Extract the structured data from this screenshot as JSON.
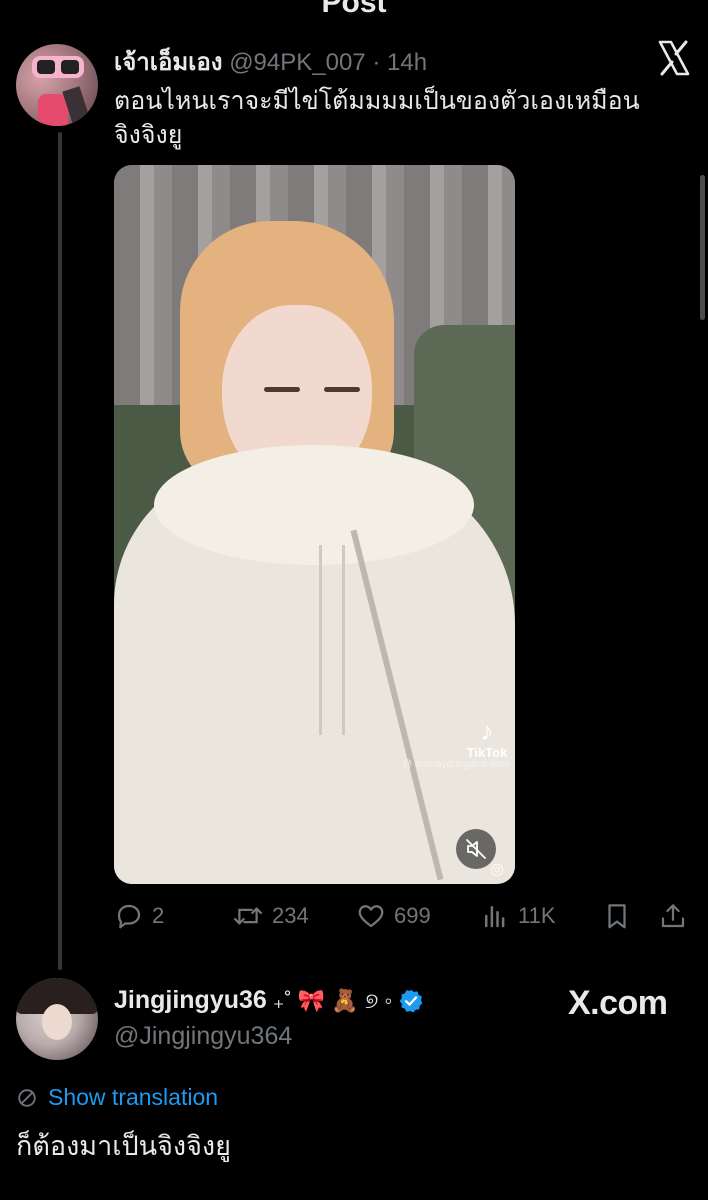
{
  "header": {
    "title": "Post"
  },
  "tweet": {
    "name": "เจ้าเอ็มเอง",
    "handle": "@94PK_007",
    "separator": "·",
    "time": "14h",
    "text_line1": "ตอนไหนเราจะมีไข่โต้มมมมเป็นของตัวเองเหมือน",
    "text_line2": "จิงจิงยู",
    "close_icon": "x-logo-icon"
  },
  "media": {
    "watermark_brand": "TikTok",
    "watermark_glyph": "♪",
    "watermark_user": "@ accnaydungdeduless",
    "mute_icon": "muted-speaker-icon",
    "weibo_icon": "weibo-icon"
  },
  "actions": {
    "replies": "2",
    "reposts": "234",
    "likes": "699",
    "views": "11K",
    "bookmark_icon": "bookmark-icon",
    "share_icon": "share-icon"
  },
  "quote": {
    "name": "Jingjingyu36",
    "emoji": "₊˚ 🎀 🧸 ୭ ◦",
    "verified_color": "#1d9bf0",
    "handle": "@Jingjingyu364",
    "brand": "X.com"
  },
  "translation": {
    "label": "Show translation"
  },
  "reply": {
    "text": "ก็ต้องมาเป็นจิงจิงยู"
  },
  "colors": {
    "background": "#000000",
    "primary_text": "#e7e9ea",
    "secondary_text": "#71767b",
    "accent": "#1d9bf0"
  }
}
